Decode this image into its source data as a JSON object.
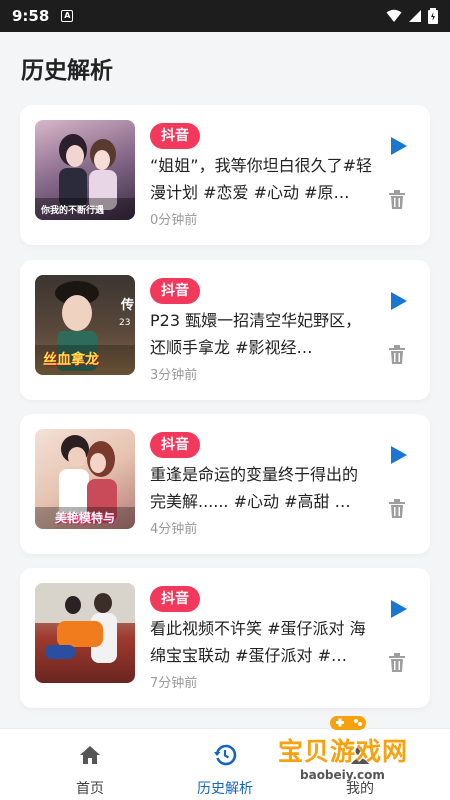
{
  "status_bar": {
    "time": "9:58",
    "indicator": "A"
  },
  "page": {
    "title": "历史解析"
  },
  "history": [
    {
      "source": "抖音",
      "title": "“姐姐”，我等你坦白很久了#轻漫计划 #恋爱 #心动 #原…",
      "time_ago": "0分钟前",
      "thumb_text": "你我的不断行遇"
    },
    {
      "source": "抖音",
      "title": "P23 甄嬛一招清空华妃野区，还顺手拿龙 #影视经…",
      "time_ago": "3分钟前",
      "thumb_text": "丝血拿龙"
    },
    {
      "source": "抖音",
      "title": "重逢是命运的变量终于得出的完美解...... #心动 #高甜 …",
      "time_ago": "4分钟前",
      "thumb_text": "美艳模特与"
    },
    {
      "source": "抖音",
      "title": "看此视频不许笑 #蛋仔派对 海绵宝宝联动 #蛋仔派对 #…",
      "time_ago": "7分钟前",
      "thumb_text": ""
    }
  ],
  "tabs": [
    {
      "label": "首页"
    },
    {
      "label": "历史解析"
    },
    {
      "label": "我的"
    }
  ],
  "watermark": {
    "text": "宝贝游戏网",
    "url": "baobeiy.com"
  },
  "colors": {
    "accent": "#1565c0",
    "badge": "#f2385b",
    "play": "#1976d2"
  }
}
